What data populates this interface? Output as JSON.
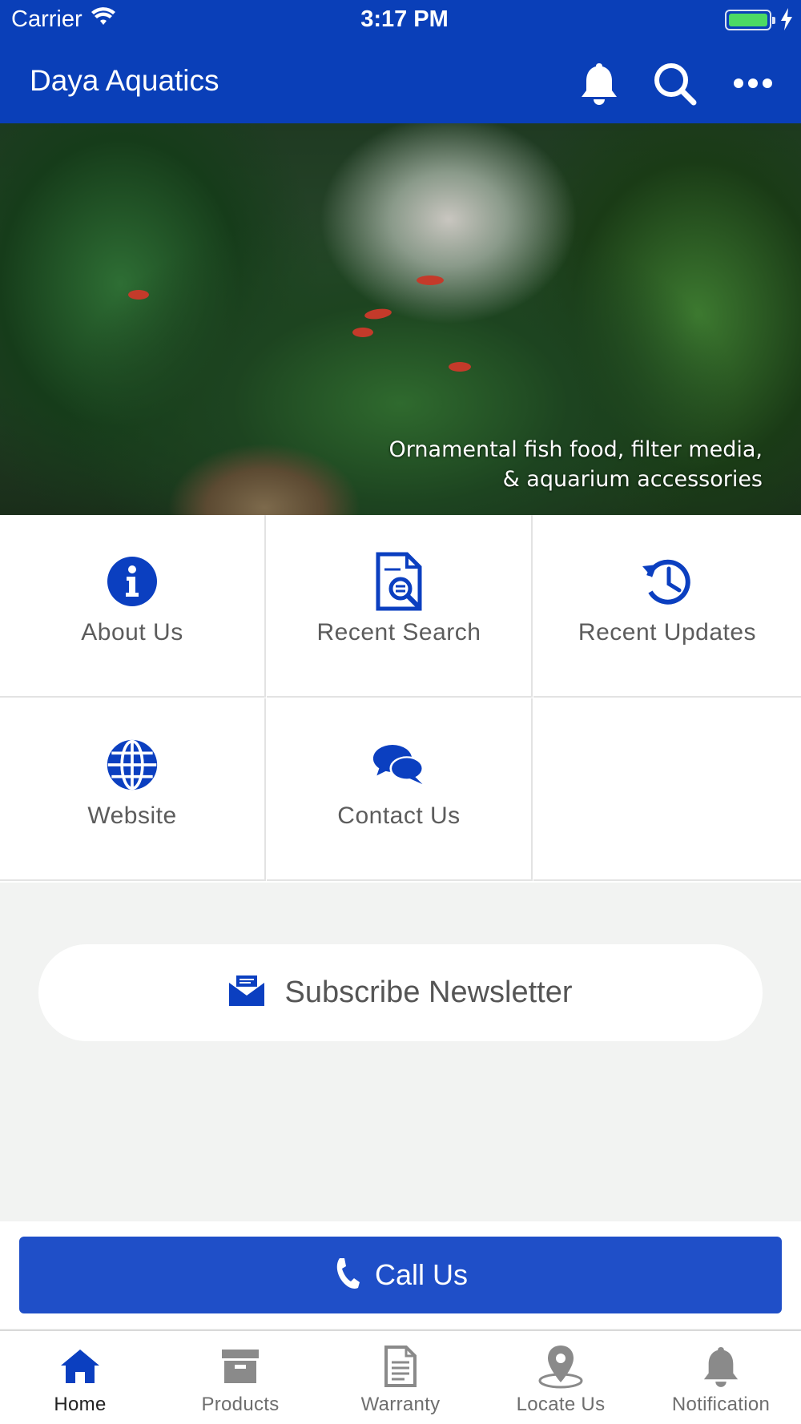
{
  "status_bar": {
    "carrier": "Carrier",
    "time": "3:17 PM"
  },
  "header": {
    "title": "Daya Aquatics",
    "icons": [
      "bell-icon",
      "search-icon",
      "more-icon"
    ]
  },
  "hero": {
    "caption_line1": "Ornamental fish food, filter media,",
    "caption_line2": "& aquarium accessories"
  },
  "grid": {
    "items": [
      {
        "label": "About Us",
        "icon": "info-icon"
      },
      {
        "label": "Recent Search",
        "icon": "document-search-icon"
      },
      {
        "label": "Recent Updates",
        "icon": "history-clock-icon"
      },
      {
        "label": "Website",
        "icon": "globe-icon"
      },
      {
        "label": "Contact Us",
        "icon": "chat-bubbles-icon"
      }
    ]
  },
  "subscribe": {
    "label": "Subscribe Newsletter",
    "icon": "envelope-icon"
  },
  "call": {
    "label": "Call Us",
    "icon": "phone-icon"
  },
  "tabs": [
    {
      "label": "Home",
      "icon": "home-icon",
      "active": true
    },
    {
      "label": "Products",
      "icon": "archive-box-icon",
      "active": false
    },
    {
      "label": "Warranty",
      "icon": "document-icon",
      "active": false
    },
    {
      "label": "Locate Us",
      "icon": "map-pin-icon",
      "active": false
    },
    {
      "label": "Notification",
      "icon": "bell-icon",
      "active": false
    }
  ],
  "colors": {
    "primary": "#0a3fb8",
    "call_button": "#1f4fc8",
    "icon_blue": "#0b3fc0",
    "tab_inactive": "#8a8a8a"
  }
}
